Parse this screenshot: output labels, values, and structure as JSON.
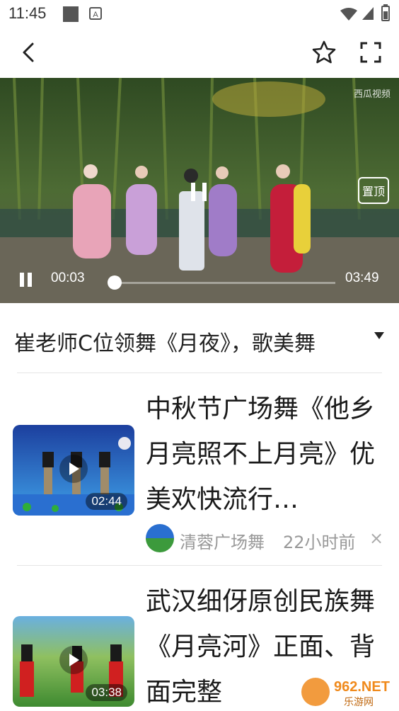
{
  "status": {
    "time": "11:45"
  },
  "nav": {
    "back_icon": "back-arrow-icon",
    "favorite_icon": "star-icon",
    "fullscreen_icon": "fullscreen-icon"
  },
  "player": {
    "current_time": "00:03",
    "duration": "03:49",
    "progress": 0.013,
    "watermark": "西瓜视频",
    "top_button": "置顶"
  },
  "video": {
    "title": "崔老师C位领舞《月夜》，歌美舞"
  },
  "recommendations": [
    {
      "title": "中秋节广场舞《他乡月亮照不上月亮》优美欢快流行…",
      "author": "清蓉广场舞",
      "time_ago": "22小时前",
      "duration": "02:44",
      "close": "×"
    },
    {
      "title": "武汉细伢原创民族舞《月亮河》正面、背面完整",
      "duration": "03:38"
    }
  ],
  "site_watermark": "962.NET 乐游网",
  "colors": {
    "accent": "#ffffff",
    "title_text": "#222222",
    "meta_text": "#999999"
  }
}
